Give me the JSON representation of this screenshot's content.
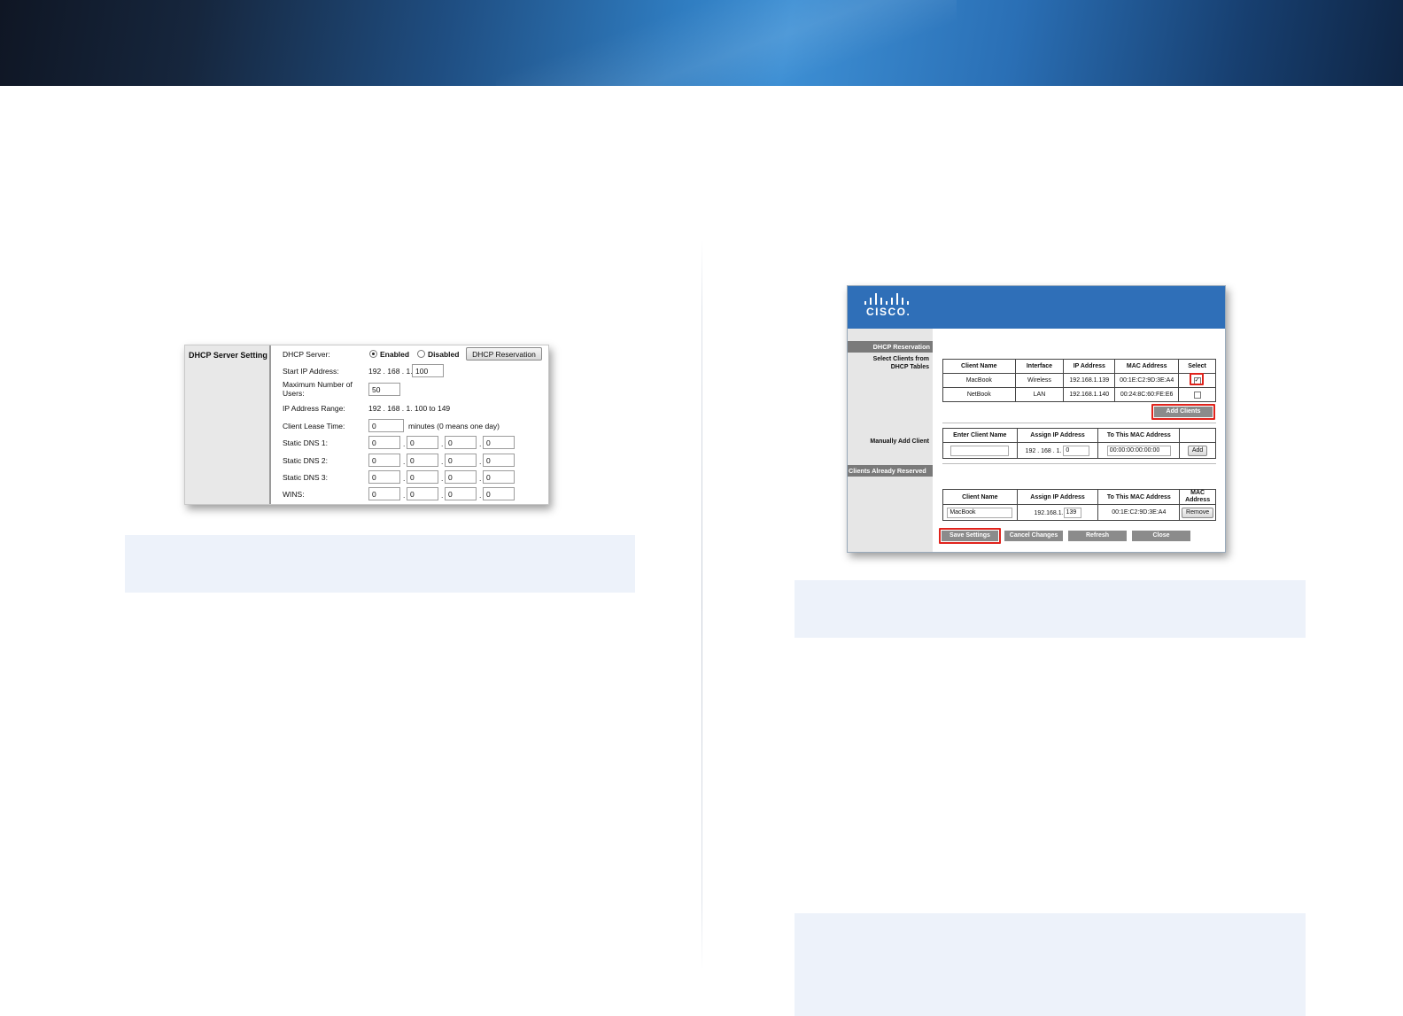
{
  "dhcp_server_setting": {
    "section_title": "DHCP Server Setting",
    "dhcp_server_label": "DHCP Server:",
    "enabled_label": "Enabled",
    "disabled_label": "Disabled",
    "reservation_button": "DHCP Reservation",
    "start_ip_label": "Start IP Address:",
    "start_ip_prefix": "192 . 168 . 1.",
    "start_ip_value": "100",
    "max_users_label": "Maximum Number of Users:",
    "max_users_value": "50",
    "ip_range_label": "IP Address Range:",
    "ip_range_value": "192 . 168 . 1. 100 to 149",
    "lease_time_label": "Client Lease Time:",
    "lease_time_value": "0",
    "lease_time_note": "minutes (0 means one day)",
    "dns_rows": [
      {
        "label": "Static DNS 1:",
        "octets": [
          "0",
          "0",
          "0",
          "0"
        ]
      },
      {
        "label": "Static DNS 2:",
        "octets": [
          "0",
          "0",
          "0",
          "0"
        ]
      },
      {
        "label": "Static DNS 3:",
        "octets": [
          "0",
          "0",
          "0",
          "0"
        ]
      },
      {
        "label": "WINS:",
        "octets": [
          "0",
          "0",
          "0",
          "0"
        ]
      }
    ],
    "dot": "."
  },
  "dhcp_reservation": {
    "logo_text": "CISCO.",
    "side": {
      "reservation_title": "DHCP Reservation",
      "select_clients": "Select Clients from DHCP Tables",
      "manually_add": "Manually Add Client",
      "already_reserved": "Clients Already Reserved"
    },
    "clients_table": {
      "headers": [
        "Client Name",
        "Interface",
        "IP Address",
        "MAC Address",
        "Select"
      ],
      "rows": [
        {
          "name": "MacBook",
          "interface": "Wireless",
          "ip": "192.168.1.139",
          "mac": "00:1E:C2:9D:3E:A4",
          "checked": "✓"
        },
        {
          "name": "NetBook",
          "interface": "LAN",
          "ip": "192.168.1.140",
          "mac": "00:24:8C:60:FE:E6",
          "checked": ""
        }
      ]
    },
    "add_clients_button": "Add Clients",
    "manual_table": {
      "headers": [
        "Enter Client Name",
        "Assign IP Address",
        "To This MAC Address"
      ],
      "ip_prefix": "192 . 168 . 1.",
      "ip_value": "0",
      "mac_value": "00:00:00:00:00:00",
      "add_button": "Add"
    },
    "reserved_table": {
      "headers": [
        "Client Name",
        "Assign IP Address",
        "To This MAC Address",
        "MAC Address"
      ],
      "row": {
        "name": "MacBook",
        "ip_prefix": "192.168.1.",
        "ip_value": "139",
        "mac": "00:1E:C2:9D:3E:A4"
      },
      "remove_button": "Remove"
    },
    "buttons": {
      "save": "Save Settings",
      "cancel": "Cancel Changes",
      "refresh": "Refresh",
      "close": "Close"
    },
    "highlight_color": "#e0231c"
  },
  "colors": {
    "note_background": "#edf2fa",
    "cisco_blue": "#2f6fb8"
  }
}
